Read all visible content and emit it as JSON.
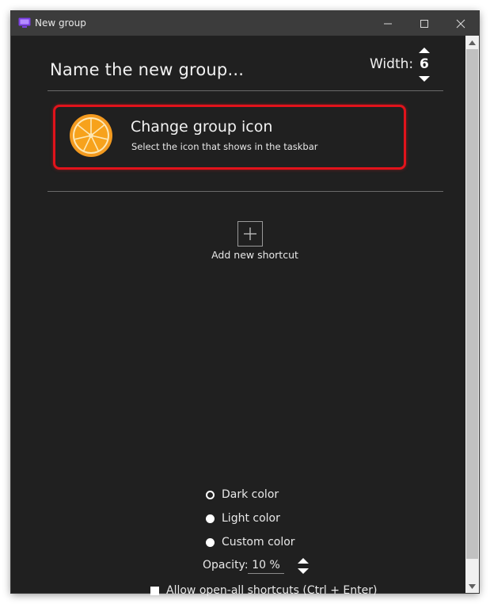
{
  "window": {
    "title": "New group",
    "background": "#202020",
    "titlebar_color": "#3c3c3c"
  },
  "header": {
    "group_name": "Name the new group...",
    "width_label": "Width:",
    "width_value": "6"
  },
  "icon_card": {
    "title": "Change group icon",
    "subtitle": "Select the icon that shows in the taskbar",
    "icon": "orange-slice-icon",
    "highlight_color": "#e2131b"
  },
  "shortcuts": {
    "add_label": "Add new shortcut",
    "add_icon": "plus-icon"
  },
  "colors": {
    "options": [
      {
        "label": "Dark color",
        "selected": true
      },
      {
        "label": "Light color",
        "selected": false
      },
      {
        "label": "Custom color",
        "selected": false
      }
    ]
  },
  "opacity": {
    "label": "Opacity:",
    "value": "10 %"
  },
  "allow_open_all": {
    "label": "Allow open-all shortcuts (Ctrl + Enter)",
    "checked": false
  }
}
